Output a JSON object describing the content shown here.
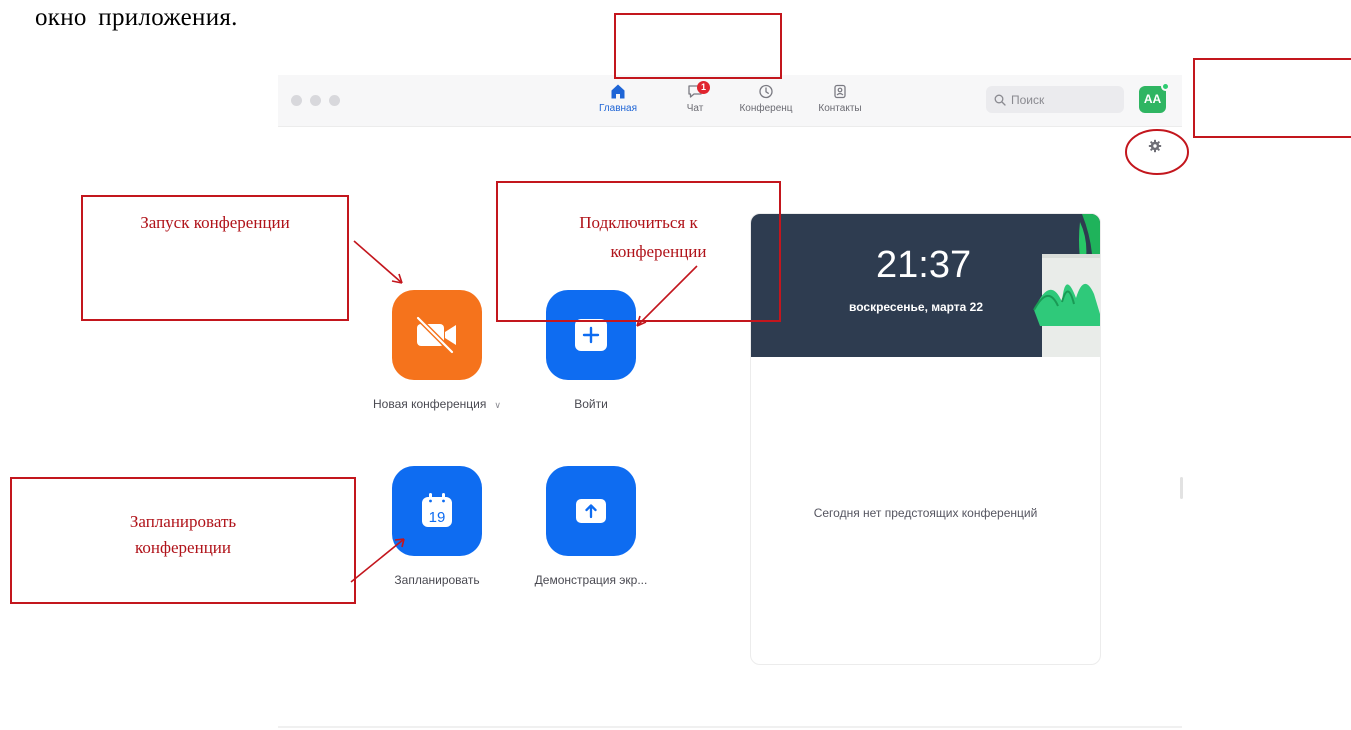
{
  "document": {
    "caption": "окно приложения."
  },
  "app": {
    "tabs": [
      {
        "label": "Главная",
        "icon": "home-icon",
        "active": true
      },
      {
        "label": "Чат",
        "icon": "chat-icon",
        "badge": "1"
      },
      {
        "label": "Конференц",
        "icon": "clock-icon"
      },
      {
        "label": "Контакты",
        "icon": "contacts-icon"
      }
    ],
    "search": {
      "placeholder": "Поиск",
      "value": ""
    },
    "avatar": {
      "initials": "AA"
    },
    "actions": [
      {
        "label": "Новая конференция",
        "icon": "video-off-icon"
      },
      {
        "label": "Войти",
        "icon": "plus-icon"
      },
      {
        "label": "Запланировать",
        "icon": "calendar-icon",
        "calendar_day": "19"
      },
      {
        "label": "Демонстрация экр...",
        "icon": "share-up-icon"
      }
    ],
    "panel": {
      "time": "21:37",
      "date": "воскресенье, марта 22",
      "empty_text": "Сегодня нет предстоящих конференций"
    }
  },
  "annotations": {
    "start": "Запуск конференции",
    "join_line1": "Подключиться к",
    "join_line2": "конференции",
    "schedule_line1": "Запланировать",
    "schedule_line2": "конференции"
  },
  "colors": {
    "accent_blue": "#0e6cf1",
    "accent_orange": "#f5731c",
    "annotation_red": "#c3161d",
    "avatar_green": "#2fb562"
  }
}
